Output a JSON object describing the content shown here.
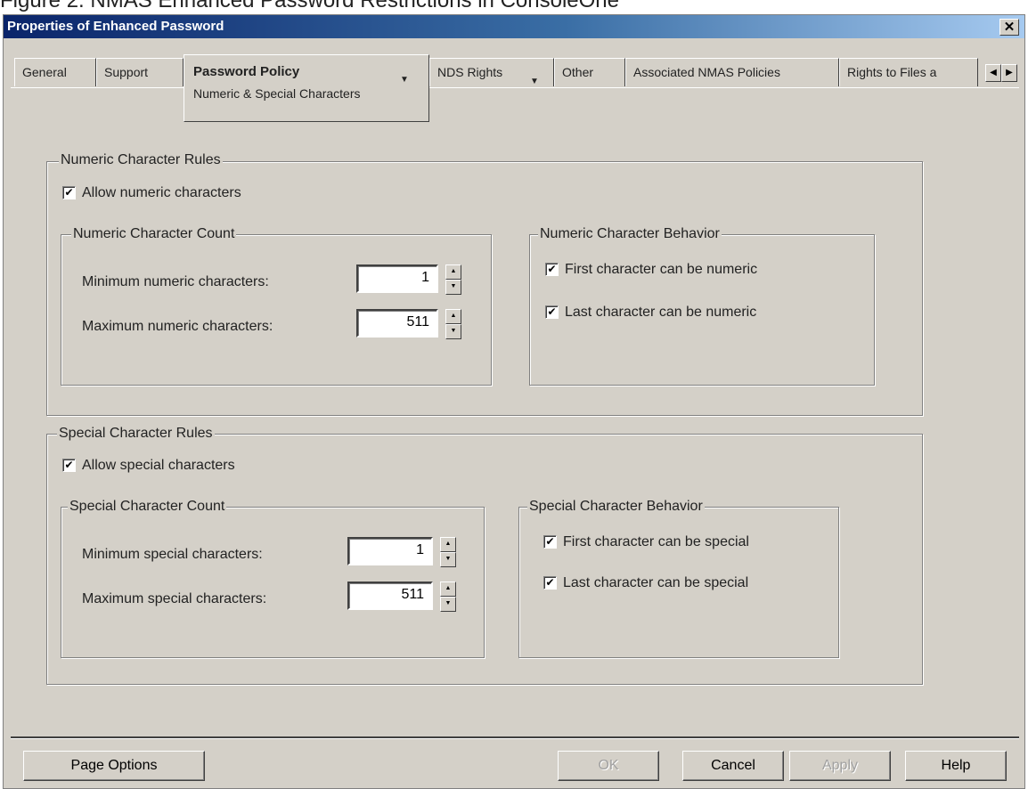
{
  "document": {
    "caption": "Figure 2. NMAS Enhanced Password Restrictions in ConsoleOne"
  },
  "window": {
    "title": "Properties of Enhanced Password",
    "close_glyph": "✕"
  },
  "tabs": [
    {
      "label": "General"
    },
    {
      "label": "Support"
    },
    {
      "label": "Password Policy",
      "sublabel": "Numeric & Special Characters",
      "active": true
    },
    {
      "label": "NDS Rights"
    },
    {
      "label": "Other"
    },
    {
      "label": "Associated NMAS Policies"
    },
    {
      "label": "Rights to Files a"
    }
  ],
  "numeric_rules": {
    "title": "Numeric Character Rules",
    "allow": {
      "label": "Allow numeric characters",
      "checked": true
    },
    "count": {
      "title": "Numeric Character Count",
      "min_label": "Minimum numeric characters:",
      "min_value": "1",
      "max_label": "Maximum numeric characters:",
      "max_value": "511"
    },
    "behavior": {
      "title": "Numeric Character Behavior",
      "first_label": "First character can be numeric",
      "first_checked": true,
      "last_label": "Last character can be numeric",
      "last_checked": true
    }
  },
  "special_rules": {
    "title": "Special Character Rules",
    "allow": {
      "label": "Allow special characters",
      "checked": true
    },
    "count": {
      "title": "Special Character Count",
      "min_label": "Minimum special characters:",
      "min_value": "1",
      "max_label": "Maximum special characters:",
      "max_value": "511"
    },
    "behavior": {
      "title": "Special Character Behavior",
      "first_label": "First character can be special",
      "first_checked": true,
      "last_label": "Last character can be special",
      "last_checked": true
    }
  },
  "buttons": {
    "page_options": "Page Options",
    "ok": "OK",
    "cancel": "Cancel",
    "apply": "Apply",
    "help": "Help"
  },
  "glyphs": {
    "check": "✔",
    "dropdown": "▼",
    "left": "◀",
    "right": "▶",
    "up": "▲",
    "down": "▼"
  }
}
